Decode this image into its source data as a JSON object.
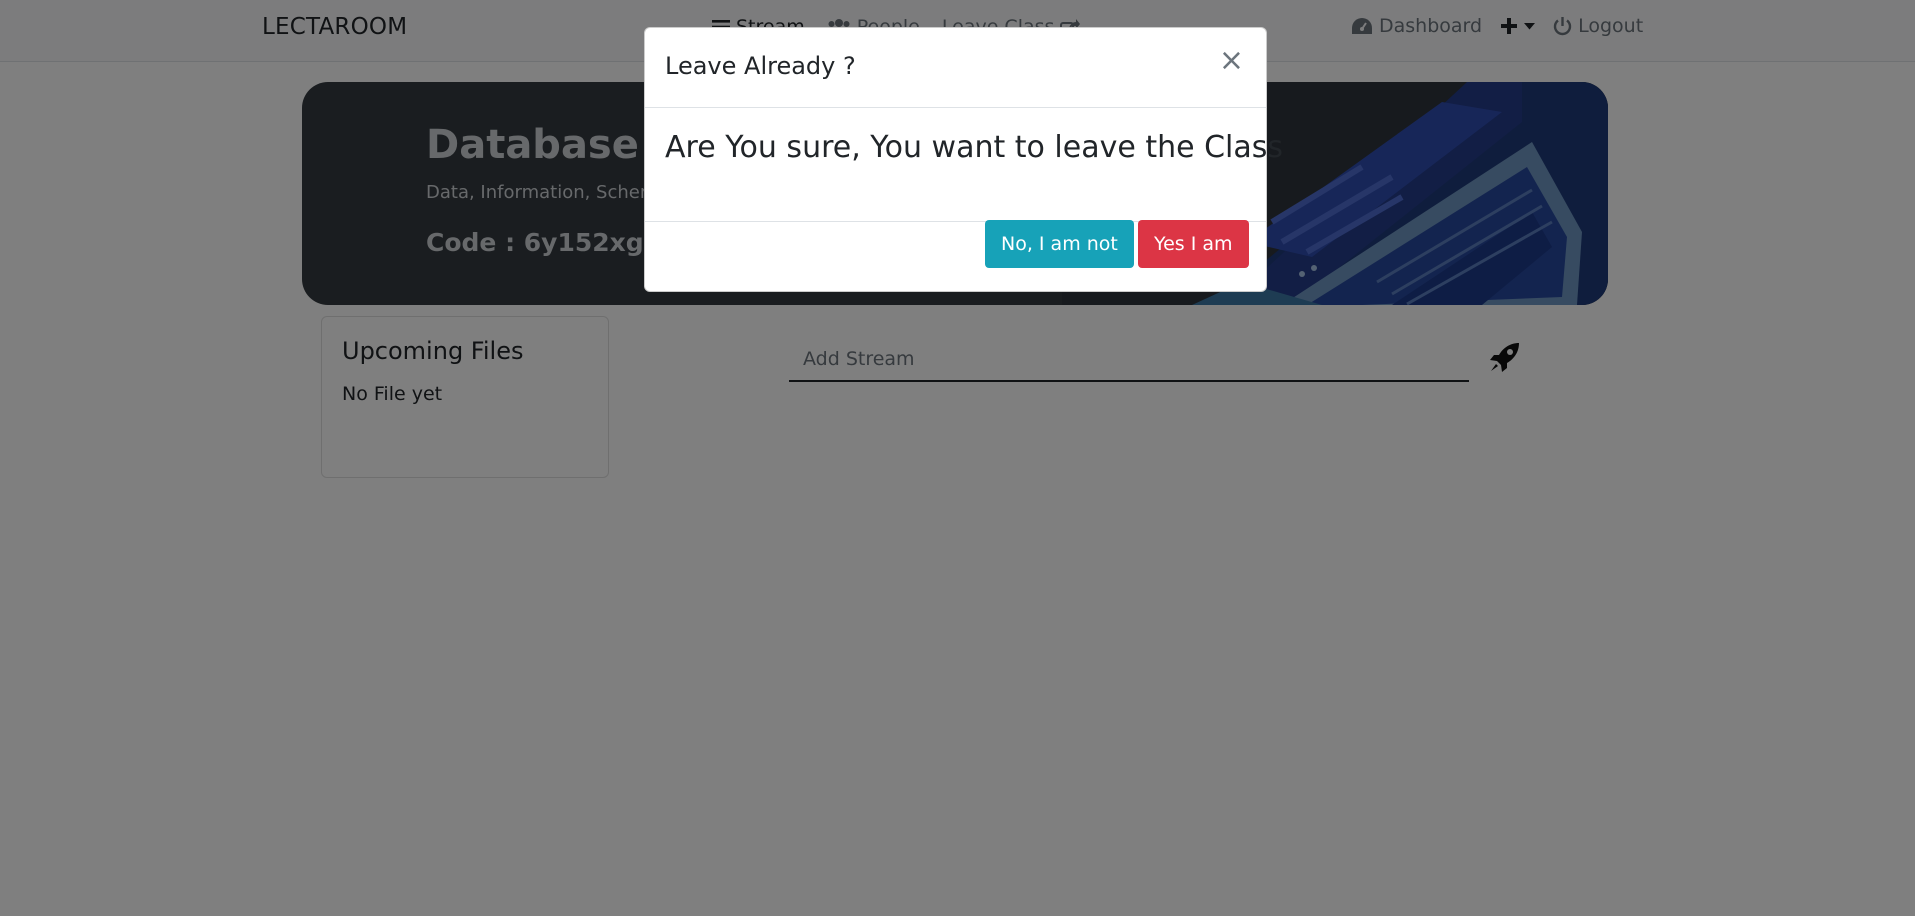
{
  "navbar": {
    "brand": "LECTAROOM",
    "links": [
      {
        "label": "Stream",
        "icon": "bars-icon"
      },
      {
        "label": "People",
        "icon": "users-icon"
      },
      {
        "label": "Leave Class",
        "icon": "share-icon"
      }
    ],
    "dashboard_label": "Dashboard",
    "logout_label": "Logout"
  },
  "hero": {
    "title": "Database Sy",
    "description": "Data, Information, Schem",
    "code": "Code : 6y152xg"
  },
  "upcoming": {
    "title": "Upcoming Files",
    "empty_text": "No File yet"
  },
  "stream": {
    "placeholder": "Add Stream",
    "submit_icon": "rocket-icon"
  },
  "modal": {
    "title": "Leave Already ?",
    "close_glyph": "×",
    "message": "Are You sure, You want to leave the Class",
    "no_label": "No, I am not",
    "yes_label": "Yes I am"
  },
  "colors": {
    "backdrop": "rgba(0,0,0,0.5)",
    "btn_no": "#17a2b8",
    "btn_yes": "#dc3545",
    "hero_bg": "#343a40"
  }
}
